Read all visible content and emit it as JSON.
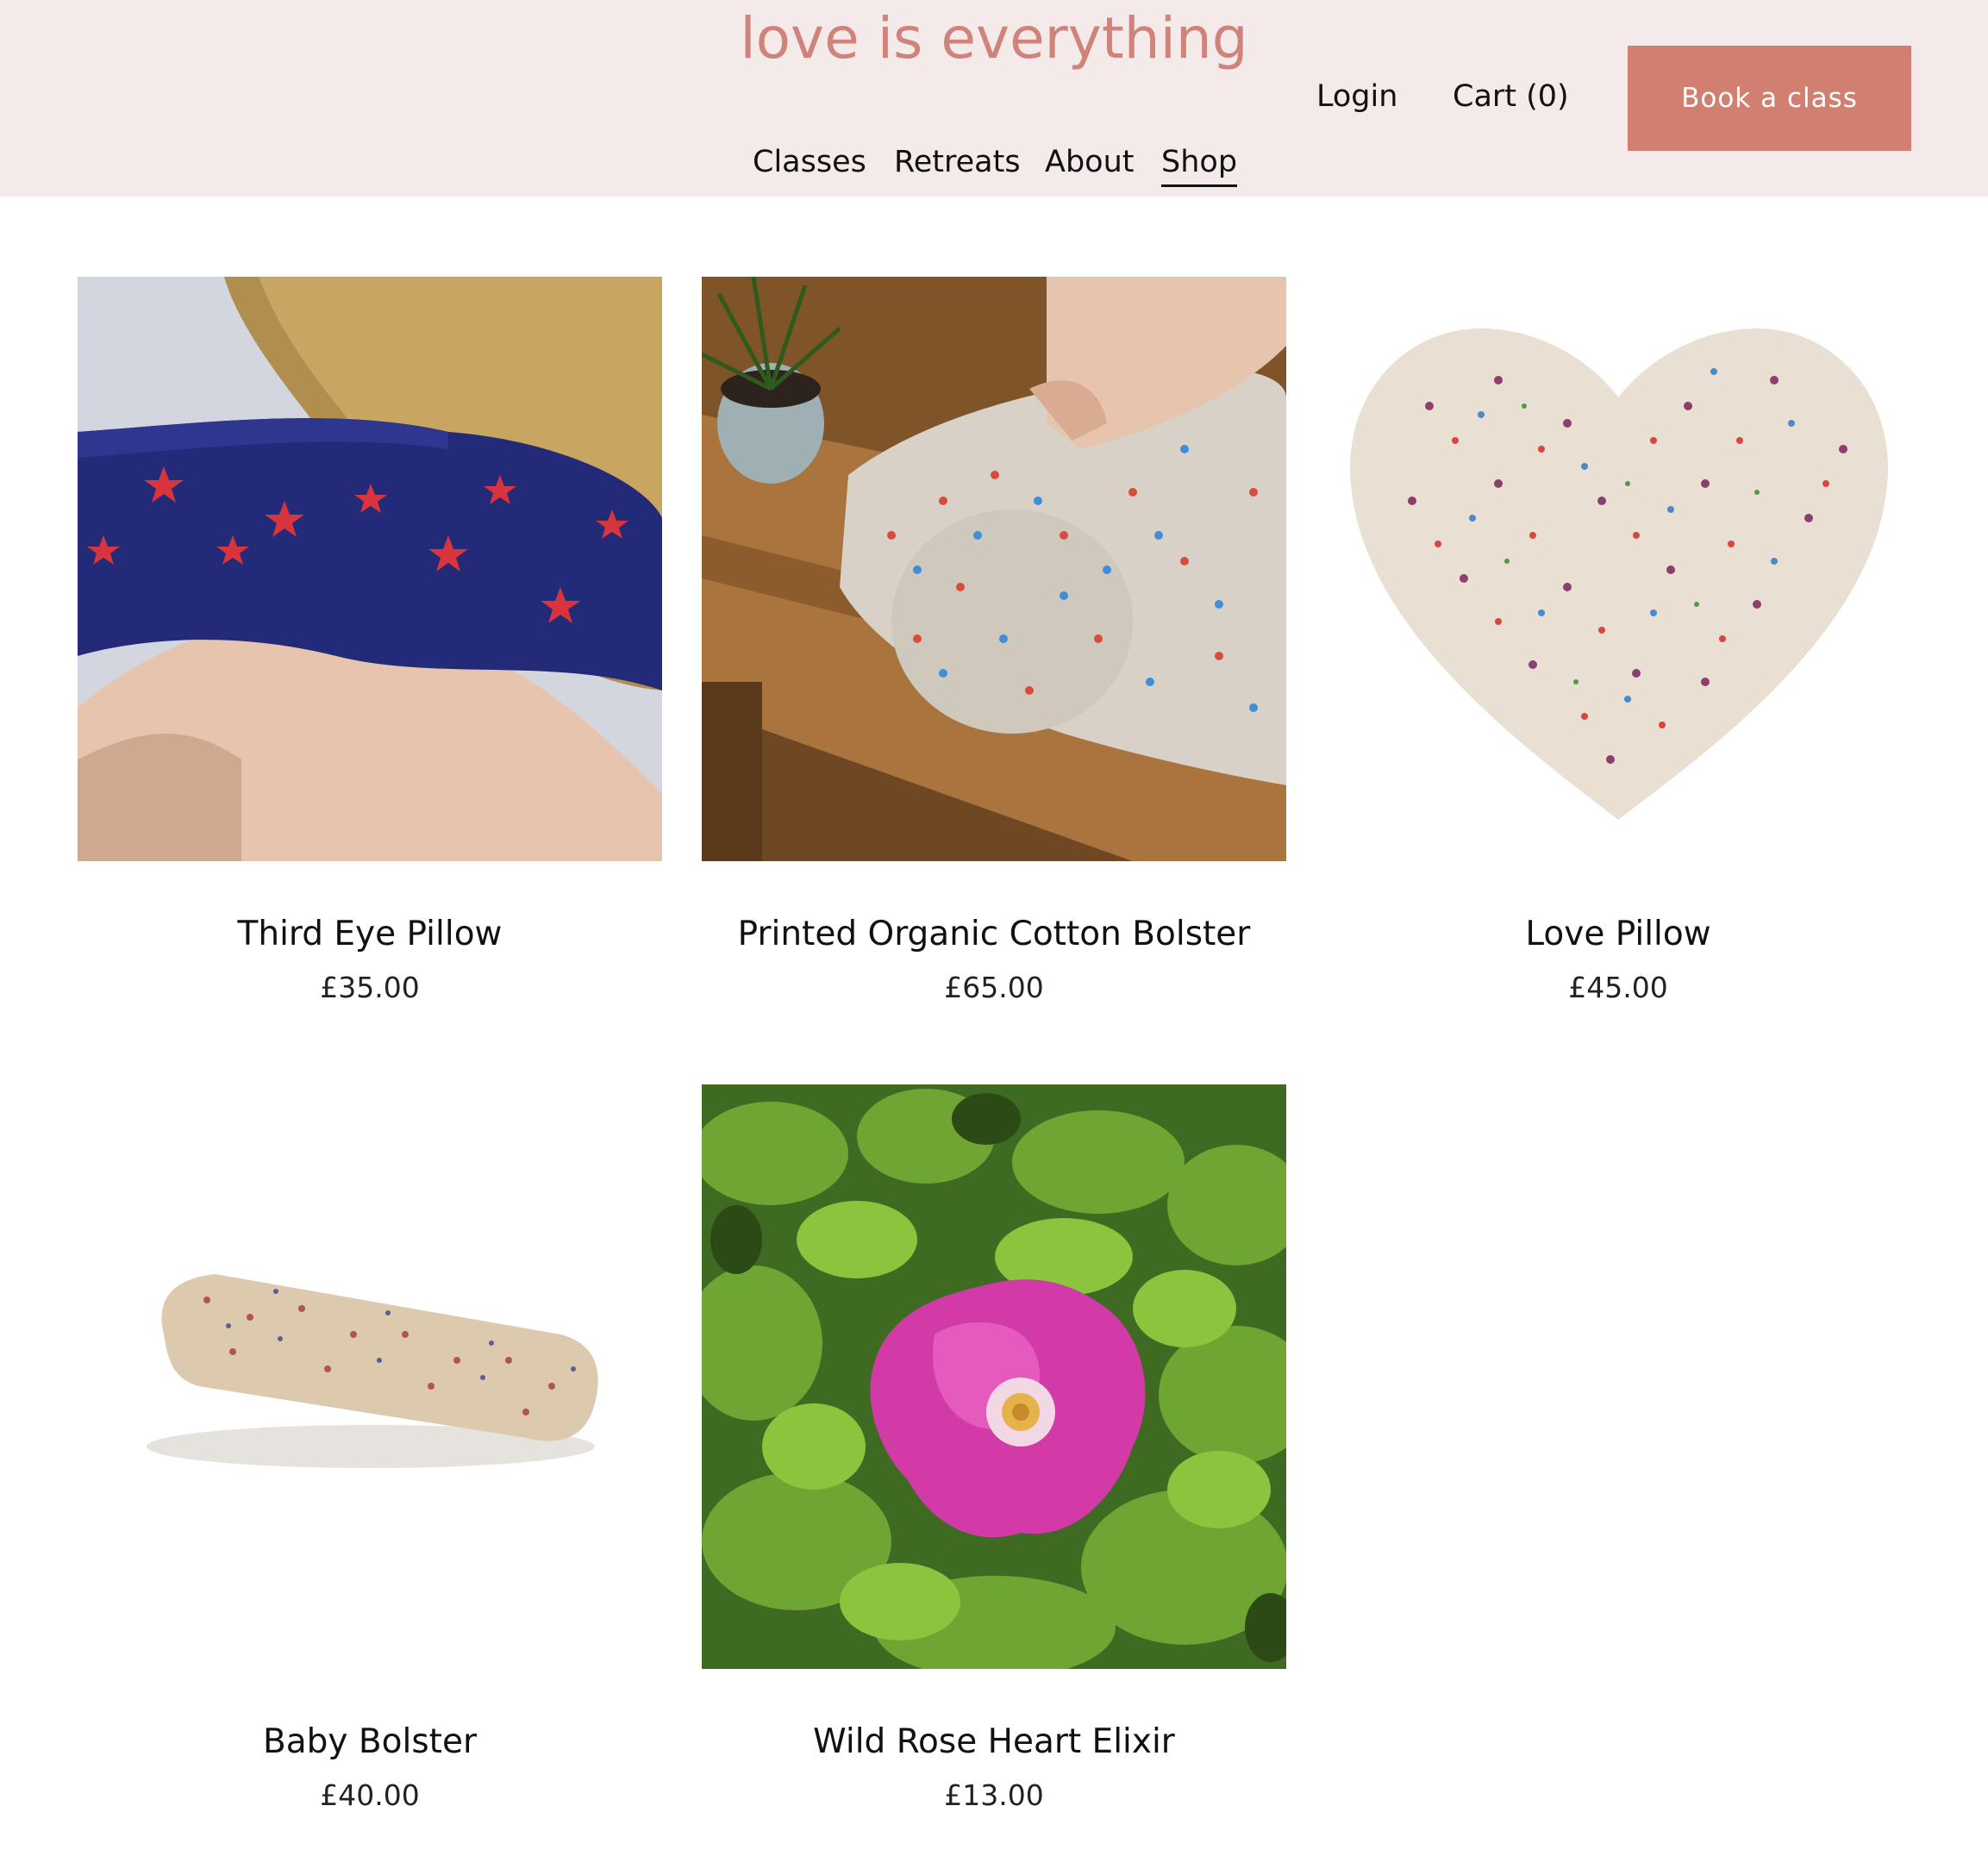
{
  "site": {
    "title": "love is everything"
  },
  "nav": {
    "items": [
      {
        "label": "Classes"
      },
      {
        "label": "Retreats"
      },
      {
        "label": "About"
      },
      {
        "label": "Shop"
      }
    ],
    "active": "Shop"
  },
  "header": {
    "login_label": "Login",
    "cart_label": "Cart (0)",
    "book_label": "Book a class"
  },
  "colors": {
    "header_bg": "#f5eaea",
    "brand": "#d0837a",
    "button": "#d07f71"
  },
  "products": [
    {
      "name": "Third Eye Pillow",
      "price": "£35.00",
      "image": "navy-star-pillow-in-hand"
    },
    {
      "name": "Printed Organic Cotton Bolster",
      "price": "£65.00",
      "image": "printed-bolster-on-floor"
    },
    {
      "name": "Love Pillow",
      "price": "£45.00",
      "image": "floral-heart-pillow"
    },
    {
      "name": "Baby Bolster",
      "price": "£40.00",
      "image": "floral-baby-bolster"
    },
    {
      "name": "Wild Rose Heart Elixir",
      "price": "£13.00",
      "image": "pink-wild-rose"
    }
  ]
}
